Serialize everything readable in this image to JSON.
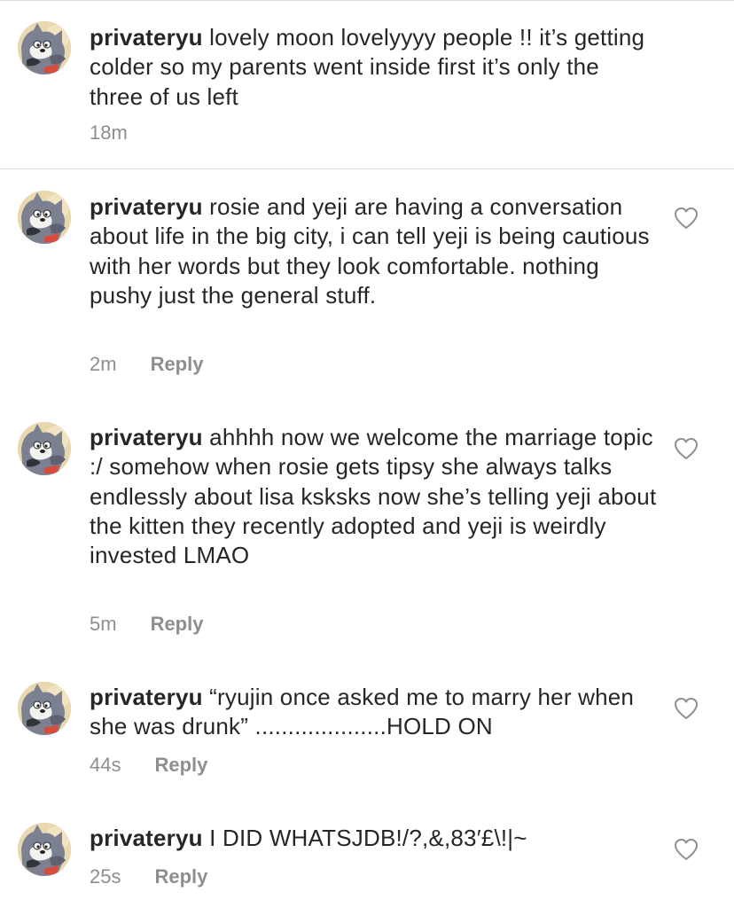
{
  "comments": [
    {
      "username": "privateryu",
      "text": "lovely moon lovelyyyy people !! it’s getting colder so my parents went inside first it’s only the three of us left",
      "time": "18m"
    },
    {
      "username": "privateryu",
      "text": "rosie and yeji are having a conversation about life in the big city, i can tell yeji is being cautious with her words but they look comfortable. nothing pushy just the general stuff.",
      "time": "2m",
      "reply_label": "Reply"
    },
    {
      "username": "privateryu",
      "text": "ahhhh now we welcome the marriage topic :/ somehow when rosie gets tipsy she always talks endlessly about lisa ksksks now she’s telling yeji about the kitten they recently adopted and yeji is weirdly invested LMAO",
      "time": "5m",
      "reply_label": "Reply"
    },
    {
      "username": "privateryu",
      "text": "“ryujin once asked me to marry her when she was drunk” ....................HOLD ON",
      "time": "44s",
      "reply_label": "Reply"
    },
    {
      "username": "privateryu",
      "text": "I DID WHATSJDB!/?,&,83′£\\!|~",
      "time": "25s",
      "reply_label": "Reply"
    }
  ],
  "icons": {
    "avatar": "tom-cat-avatar-icon",
    "like": "heart-outline-icon"
  },
  "colors": {
    "text": "#262626",
    "muted": "#8e8e8e",
    "divider": "#dbdbdb"
  }
}
